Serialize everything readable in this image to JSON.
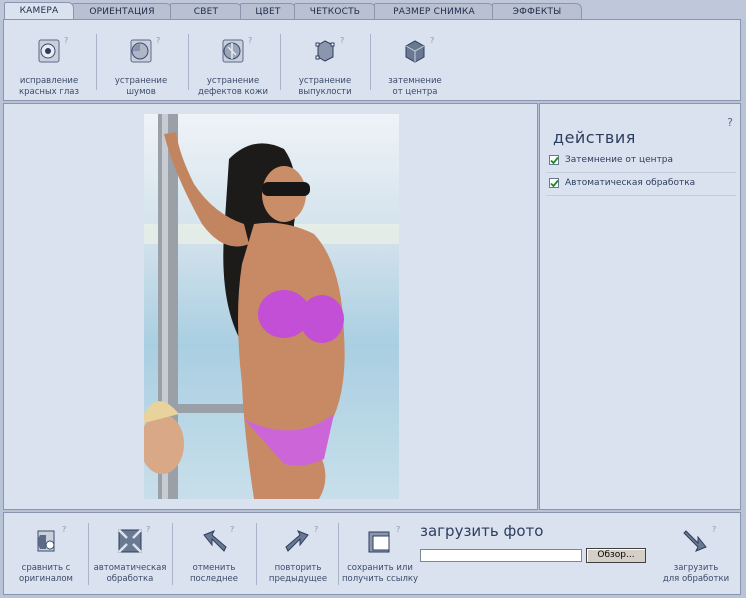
{
  "tabs": [
    "КАМЕРА",
    "ОРИЕНТАЦИЯ",
    "СВЕТ",
    "ЦВЕТ",
    "ЧЕТКОСТЬ",
    "РАЗМЕР СНИМКА",
    "ЭФФЕКТЫ"
  ],
  "active_tab": "КАМЕРА",
  "toolbar": [
    {
      "l1": "исправление",
      "l2": "красных глаз",
      "icon": "red-eye-icon"
    },
    {
      "l1": "устранение",
      "l2": "шумов",
      "icon": "noise-icon"
    },
    {
      "l1": "устранение",
      "l2": "дефектов кожи",
      "icon": "skin-icon"
    },
    {
      "l1": "устранение",
      "l2": "выпуклости",
      "icon": "bulge-icon"
    },
    {
      "l1": "затемнение",
      "l2": "от центра",
      "icon": "vignette-icon"
    }
  ],
  "help": "?",
  "actions": {
    "title": "действия",
    "items": [
      {
        "label": "Затемнение от центра",
        "checked": true
      },
      {
        "label": "Автоматическая обработка",
        "checked": true
      }
    ]
  },
  "bottom": [
    {
      "l1": "сравнить с",
      "l2": "оригиналом",
      "icon": "compare-icon"
    },
    {
      "l1": "автоматическая",
      "l2": "обработка",
      "icon": "auto-icon"
    },
    {
      "l1": "отменить",
      "l2": "последнее",
      "icon": "undo-icon"
    },
    {
      "l1": "повторить",
      "l2": "предыдущее",
      "icon": "redo-icon"
    },
    {
      "l1": "сохранить или",
      "l2": "получить ссылку",
      "icon": "save-icon"
    }
  ],
  "upload": {
    "title": "загрузить фото",
    "browse": "Обзор...",
    "value": "",
    "l1": "загрузить",
    "l2": "для обработки"
  }
}
